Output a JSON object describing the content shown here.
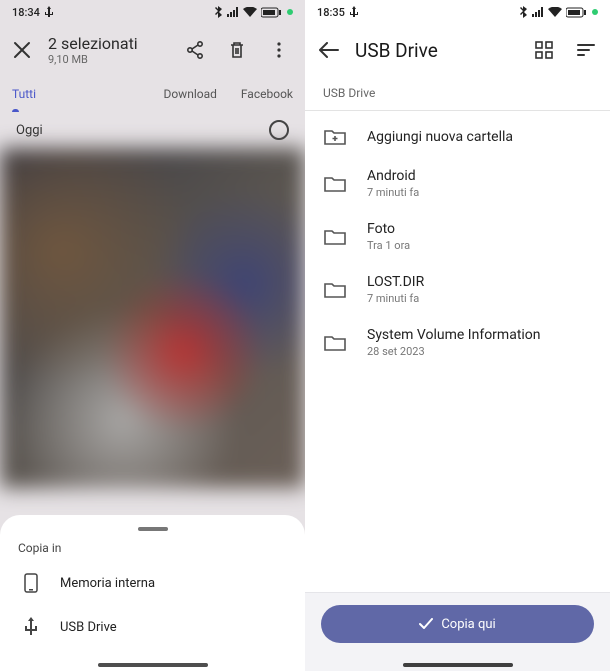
{
  "left": {
    "status": {
      "time": "18:34"
    },
    "header": {
      "title": "2 selezionati",
      "subtitle": "9,10 MB"
    },
    "tabs": {
      "all": "Tutti",
      "download": "Download",
      "facebook": "Facebook"
    },
    "date_label": "Oggi",
    "sheet": {
      "title": "Copia in",
      "items": [
        {
          "label": "Memoria interna"
        },
        {
          "label": "USB Drive"
        }
      ]
    }
  },
  "right": {
    "status": {
      "time": "18:35"
    },
    "header": {
      "title": "USB Drive"
    },
    "breadcrumb": "USB Drive",
    "new_folder_label": "Aggiungi nuova cartella",
    "folders": [
      {
        "name": "Android",
        "sub": "7 minuti fa"
      },
      {
        "name": "Foto",
        "sub": "Tra 1 ora"
      },
      {
        "name": "LOST.DIR",
        "sub": "7 minuti fa"
      },
      {
        "name": "System Volume Information",
        "sub": "28 set 2023"
      }
    ],
    "copy_label": "Copia qui"
  }
}
